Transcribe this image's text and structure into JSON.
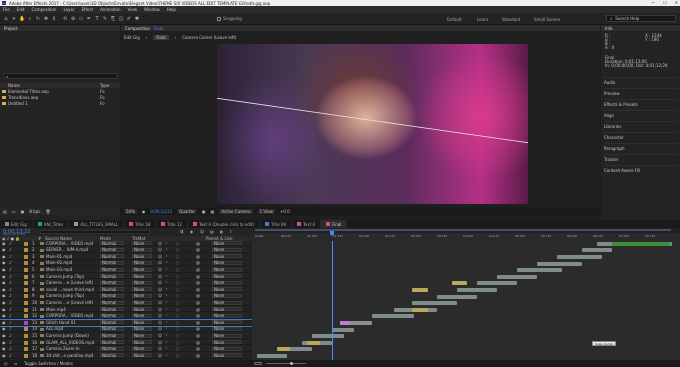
{
  "window": {
    "title": "Adobe After Effects 2017 - C:\\Users\\user\\3D Objects\\Envato\\Elegant Video\\THEME SIX VIDEOS ALL EDIT TEMPLATE GO\\edit.gig.aep",
    "min": "—",
    "max": "☐",
    "close": "✕"
  },
  "menu": [
    "File",
    "Edit",
    "Composition",
    "Layer",
    "Effect",
    "Animation",
    "View",
    "Window",
    "Help"
  ],
  "toolbar": {
    "snapping": "Snapping",
    "workspaces": [
      "Default",
      "Learn",
      "Standard",
      "Small Screen"
    ],
    "search_placeholder": "Search Help"
  },
  "project": {
    "title": "Project",
    "search": "⌕",
    "col_name": "Name",
    "col_type": "Type",
    "items": [
      {
        "name": "Elemental Titles.aep",
        "type": "Fo"
      },
      {
        "name": "Transitions.aep",
        "type": "Fo"
      },
      {
        "name": "Untitled 1",
        "type": "Fo"
      }
    ],
    "bpc": "8 bpc"
  },
  "composition": {
    "tab_label": "Composition",
    "tab_name": "Final",
    "breadcrumb": [
      "Edit Gig",
      "Final"
    ],
    "camera": "Camera Comer (Leave left)",
    "zoom": "50%",
    "time": "0;00;13;22",
    "quality": "Quarter",
    "view": "Active Camera",
    "views": "1 View",
    "offset": "+0.0"
  },
  "right_panel": {
    "title": "Info",
    "info_r": "R :",
    "info_g": "G :",
    "info_b": "B :",
    "info_a": "A : 0",
    "info_x": "X : 1244",
    "info_y": "Y : 190",
    "comp_name": "Final",
    "duration": "Duration: 0;01;13;00",
    "range": "In: 0;00;00;00, Out: 0;01;12;29",
    "items": [
      "Audio",
      "Preview",
      "Effects & Presets",
      "Align",
      "Libraries",
      "Character",
      "Paragraph",
      "Tracker",
      "Content-Aware Fill"
    ]
  },
  "timeline_tabs": [
    {
      "label": "Edit Gig",
      "color": "#888888"
    },
    {
      "label": "ANI_Titles",
      "color": "#2fa14e"
    },
    {
      "label": "ALL_TITLES_SMALL",
      "color": "#9a9a9a"
    },
    {
      "label": "Title 18",
      "color": "#c34fa3"
    },
    {
      "label": "Title 12",
      "color": "#c34fa3"
    },
    {
      "label": "Text A (Double click to edit)",
      "color": "#c34fa3"
    },
    {
      "label": "Title 09",
      "color": "#4a7cc8"
    },
    {
      "label": "Text A",
      "color": "#c34fa3"
    },
    {
      "label": "Final",
      "color": "#c34fa3"
    }
  ],
  "timecode": "0;00;13;22",
  "fps": "00412 (29.97 fps)",
  "layer_headers": {
    "num": "#",
    "source": "Source Name",
    "mode": "Mode",
    "trkmat": "TrkMat",
    "parent": "Parent & Link"
  },
  "layers": [
    {
      "n": "1",
      "name": "CORPORA... VIDEO.mp4",
      "mode": "Normal",
      "trk": "None",
      "parent": "None",
      "color": "#b08f3a"
    },
    {
      "n": "2",
      "name": "SERVER... IUM-4.mp4",
      "mode": "Normal",
      "trk": "None",
      "parent": "None",
      "color": "#b08f3a"
    },
    {
      "n": "3",
      "name": "Main-01.mp4",
      "mode": "Normal",
      "trk": "None",
      "parent": "None",
      "color": "#b08f3a"
    },
    {
      "n": "4",
      "name": "Main-02.mp4",
      "mode": "Normal",
      "trk": "None",
      "parent": "None",
      "color": "#b08f3a"
    },
    {
      "n": "5",
      "name": "Main-03.mp4",
      "mode": "Normal",
      "trk": "None",
      "parent": "None",
      "color": "#b08f3a"
    },
    {
      "n": "6",
      "name": "Camera Jump (Top)",
      "mode": "Normal",
      "trk": "None",
      "parent": "None",
      "color": "#b08f3a"
    },
    {
      "n": "7",
      "name": "Camera ...e (Leave left)",
      "mode": "Normal",
      "trk": "None",
      "parent": "None",
      "color": "#b08f3a"
    },
    {
      "n": "8",
      "name": "social ...nown third.mp4",
      "mode": "Normal",
      "trk": "None",
      "parent": "None",
      "color": "#b08f3a"
    },
    {
      "n": "9",
      "name": "Camera Jump (Top)",
      "mode": "Normal",
      "trk": "None",
      "parent": "None",
      "color": "#b08f3a"
    },
    {
      "n": "10",
      "name": "Camera ...e (Leave left)",
      "mode": "Normal",
      "trk": "None",
      "parent": "None",
      "color": "#b08f3a"
    },
    {
      "n": "11",
      "name": "Main.mp4",
      "mode": "Normal",
      "trk": "None",
      "parent": "None",
      "color": "#b08f3a"
    },
    {
      "n": "12",
      "name": "CORPORA... VIDEO.mp4",
      "mode": "Normal",
      "trk": "None",
      "parent": "None",
      "color": "#b08f3a"
    },
    {
      "n": "13",
      "name": "Glitch Hand 01",
      "mode": "Normal",
      "trk": "None",
      "parent": "None",
      "color": "#9c4fc4"
    },
    {
      "n": "14",
      "name": "ALL.mp4",
      "mode": "Normal",
      "trk": "None",
      "parent": "None",
      "color": "#b08f3a"
    },
    {
      "n": "15",
      "name": "Camera Jump (Down)",
      "mode": "Normal",
      "trk": "None",
      "parent": "None",
      "color": "#b08f3a"
    },
    {
      "n": "16",
      "name": "GLAM_ALL_VIDEOS.mp4",
      "mode": "Normal",
      "trk": "None",
      "parent": "None",
      "color": "#b08f3a"
    },
    {
      "n": "17",
      "name": "Camera Zoom In",
      "mode": "Normal",
      "trk": "None",
      "parent": "None",
      "color": "#b08f3a"
    },
    {
      "n": "18",
      "name": "3d shit...e parallax.mp4",
      "mode": "Normal",
      "trk": "None",
      "parent": "None",
      "color": "#b08f3a"
    }
  ],
  "ruler_labels": [
    "0;00s",
    "00;15f",
    "01;00f",
    "01;15f",
    "02;00f",
    "02;15f",
    "03;00f",
    "03;15f",
    "04;00f",
    "04;15f",
    "05;00f",
    "05;15f",
    "06;00f",
    "06;15f",
    "07;00f",
    "07;15f"
  ],
  "clip_label": "Snap (Jump)",
  "toggle_label": "Toggle Switches / Modes"
}
